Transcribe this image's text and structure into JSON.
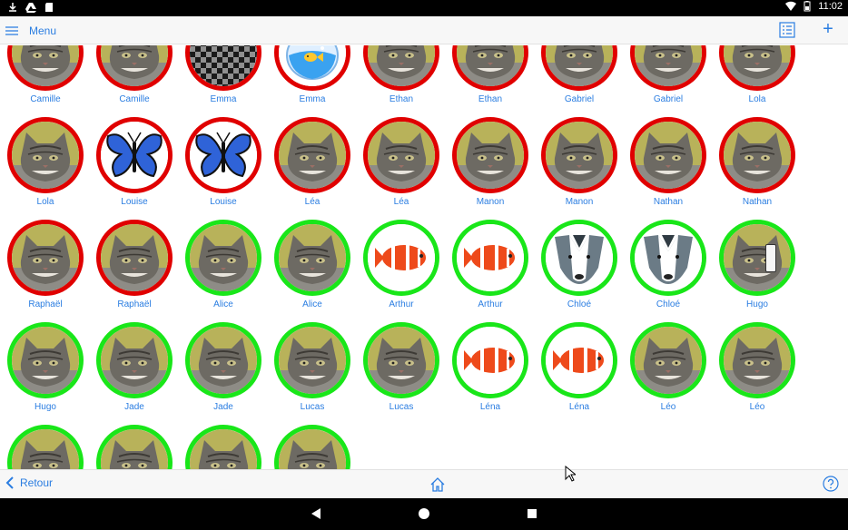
{
  "status_bar": {
    "time": "11:02"
  },
  "top_bar": {
    "menu_label": "Menu"
  },
  "bottom_bar": {
    "back_label": "Retour"
  },
  "colors": {
    "accent": "#2a7de1",
    "ring_red": "#e00000",
    "ring_green": "#19e619"
  },
  "tiles": [
    {
      "name": "Camille",
      "ring": "red",
      "image": "cat"
    },
    {
      "name": "Camille",
      "ring": "red",
      "image": "cat"
    },
    {
      "name": "Emma",
      "ring": "red",
      "image": "checker"
    },
    {
      "name": "Emma",
      "ring": "red",
      "image": "fishbowl"
    },
    {
      "name": "Ethan",
      "ring": "red",
      "image": "cat"
    },
    {
      "name": "Ethan",
      "ring": "red",
      "image": "cat"
    },
    {
      "name": "Gabriel",
      "ring": "red",
      "image": "cat"
    },
    {
      "name": "Gabriel",
      "ring": "red",
      "image": "cat"
    },
    {
      "name": "Lola",
      "ring": "red",
      "image": "cat"
    },
    {
      "name": "Lola",
      "ring": "red",
      "image": "cat"
    },
    {
      "name": "Louise",
      "ring": "red",
      "image": "butterfly"
    },
    {
      "name": "Louise",
      "ring": "red",
      "image": "butterfly"
    },
    {
      "name": "Léa",
      "ring": "red",
      "image": "cat"
    },
    {
      "name": "Léa",
      "ring": "red",
      "image": "cat"
    },
    {
      "name": "Manon",
      "ring": "red",
      "image": "cat"
    },
    {
      "name": "Manon",
      "ring": "red",
      "image": "cat"
    },
    {
      "name": "Nathan",
      "ring": "red",
      "image": "cat"
    },
    {
      "name": "Nathan",
      "ring": "red",
      "image": "cat"
    },
    {
      "name": "Raphaël",
      "ring": "red",
      "image": "cat"
    },
    {
      "name": "Raphaël",
      "ring": "red",
      "image": "cat"
    },
    {
      "name": "Alice",
      "ring": "green",
      "image": "cat"
    },
    {
      "name": "Alice",
      "ring": "green",
      "image": "cat"
    },
    {
      "name": "Arthur",
      "ring": "green",
      "image": "clownfish"
    },
    {
      "name": "Arthur",
      "ring": "green",
      "image": "clownfish"
    },
    {
      "name": "Chloé",
      "ring": "green",
      "image": "badger"
    },
    {
      "name": "Chloé",
      "ring": "green",
      "image": "badger"
    },
    {
      "name": "Hugo",
      "ring": "green",
      "image": "cat"
    },
    {
      "name": "Hugo",
      "ring": "green",
      "image": "cat"
    },
    {
      "name": "Jade",
      "ring": "green",
      "image": "cat"
    },
    {
      "name": "Jade",
      "ring": "green",
      "image": "cat"
    },
    {
      "name": "Lucas",
      "ring": "green",
      "image": "cat"
    },
    {
      "name": "Lucas",
      "ring": "green",
      "image": "cat"
    },
    {
      "name": "Léna",
      "ring": "green",
      "image": "clownfish"
    },
    {
      "name": "Léna",
      "ring": "green",
      "image": "clownfish"
    },
    {
      "name": "Léo",
      "ring": "green",
      "image": "cat"
    },
    {
      "name": "Léo",
      "ring": "green",
      "image": "cat"
    },
    {
      "name": "",
      "ring": "green",
      "image": "cat"
    },
    {
      "name": "",
      "ring": "green",
      "image": "cat"
    },
    {
      "name": "",
      "ring": "green",
      "image": "cat"
    },
    {
      "name": "",
      "ring": "green",
      "image": "cat"
    }
  ]
}
